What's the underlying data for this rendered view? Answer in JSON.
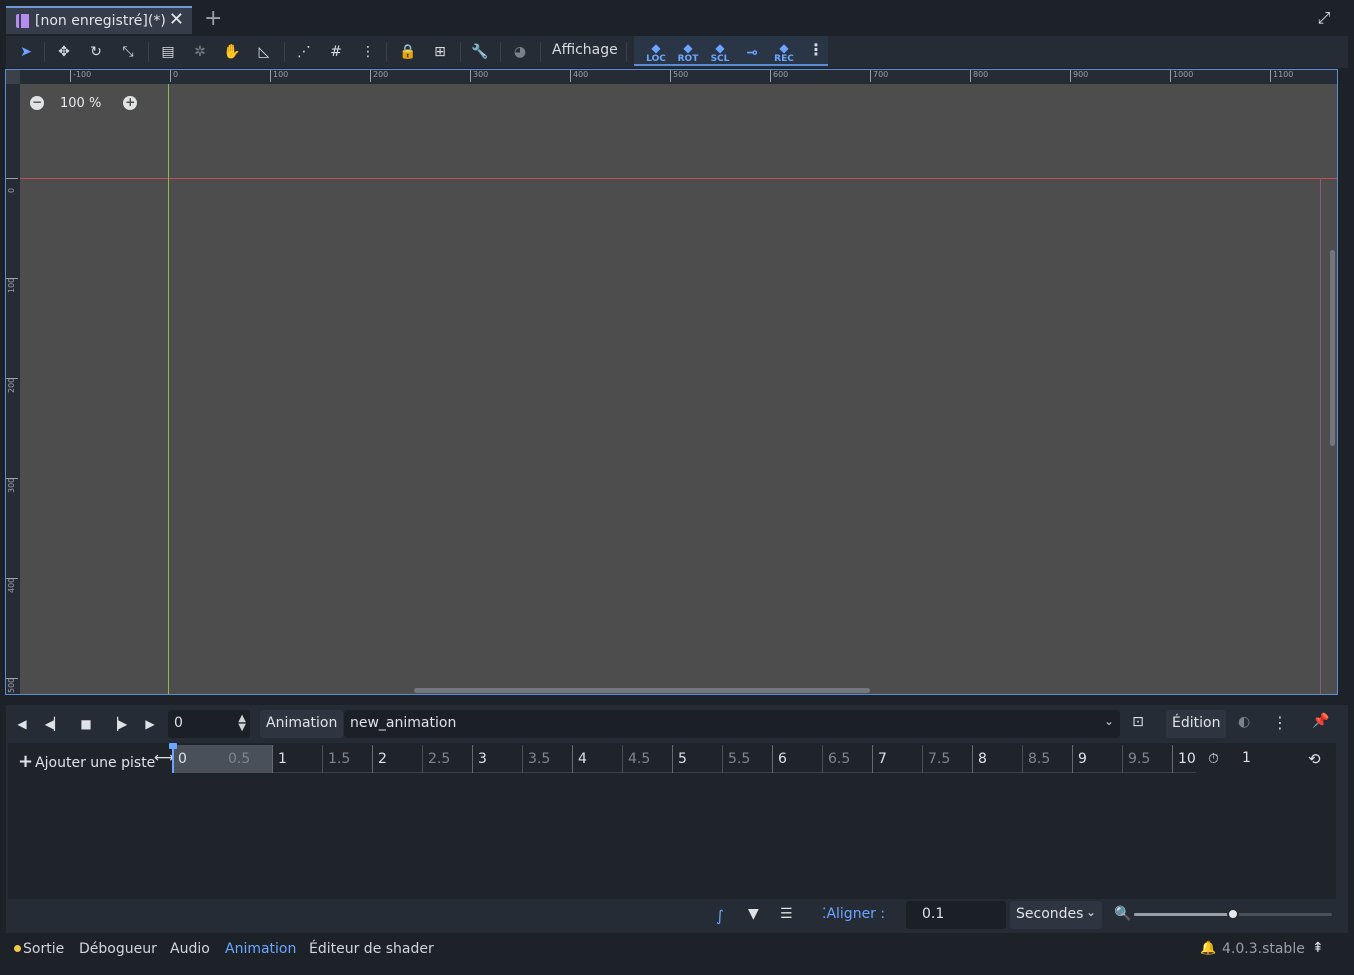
{
  "tab": {
    "title": "[non enregistré](*)",
    "icon": "scene-icon"
  },
  "toolbar": {
    "view_menu": "Affichage",
    "anim_keys": [
      {
        "label": "LOC",
        "icon": "key-location-icon"
      },
      {
        "label": "ROT",
        "icon": "key-rotation-icon"
      },
      {
        "label": "SCL",
        "icon": "key-scale-icon"
      },
      {
        "label": "",
        "icon": "insert-key-icon"
      },
      {
        "label": "REC",
        "icon": "auto-key-icon"
      }
    ]
  },
  "viewport": {
    "zoom": "100 %",
    "ruler_top": [
      "-100",
      "0",
      "100",
      "200",
      "300",
      "400",
      "500",
      "600",
      "700",
      "800",
      "900",
      "1000",
      "1100"
    ],
    "ruler_left": [
      "0",
      "100",
      "200",
      "300",
      "400",
      "500"
    ]
  },
  "animation": {
    "current_time": "0",
    "label": "Animation",
    "selected": "new_animation",
    "edit_menu": "Édition",
    "add_track": "Ajouter une piste",
    "length": "1",
    "timeline_marks": [
      "0",
      "0.5",
      "1",
      "1.5",
      "2",
      "2.5",
      "3",
      "3.5",
      "4",
      "4.5",
      "5",
      "5.5",
      "6",
      "6.5",
      "7",
      "7.5",
      "8",
      "8.5",
      "9",
      "9.5",
      "10"
    ],
    "snap_label": "Aligner :",
    "snap_value": "0.1",
    "unit": "Secondes",
    "zoom_level": 0.5
  },
  "dock": {
    "tabs": [
      "Sortie",
      "Débogueur",
      "Audio",
      "Animation",
      "Éditeur de shader"
    ],
    "active_tab": "Animation",
    "version": "4.0.3.stable"
  },
  "colors": {
    "accent": "#6aa6ff",
    "viewport_bg": "#4d4d4d",
    "x_axis": "#c94b5b",
    "y_axis": "#8fba4a"
  }
}
